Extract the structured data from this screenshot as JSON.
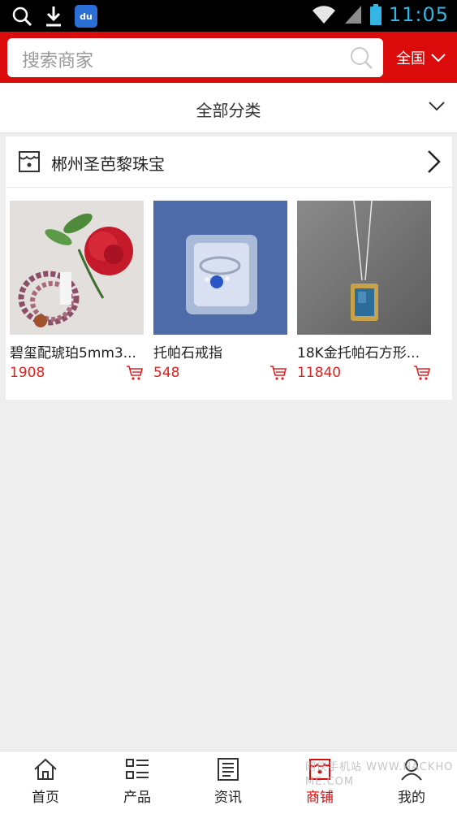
{
  "status_bar": {
    "time": "11:05",
    "icons": [
      "search-icon",
      "download-icon",
      "baidu-app-icon",
      "wifi-icon",
      "signal-icon",
      "battery-icon"
    ],
    "baidu_label": "du"
  },
  "search": {
    "placeholder": "搜索商家",
    "region_label": "全国"
  },
  "category_bar": {
    "label": "全部分类"
  },
  "shop": {
    "name": "郴州圣芭黎珠宝",
    "products": [
      {
        "name": "碧玺配琥珀5mm3...",
        "price": "1908"
      },
      {
        "name": "托帕石戒指",
        "price": "548"
      },
      {
        "name": "18K金托帕石方形...",
        "price": "11840"
      }
    ]
  },
  "bottom_nav": {
    "items": [
      {
        "label": "首页",
        "icon": "home-icon"
      },
      {
        "label": "产品",
        "icon": "list-icon"
      },
      {
        "label": "资讯",
        "icon": "news-icon"
      },
      {
        "label": "商铺",
        "icon": "shop-icon",
        "active": true
      },
      {
        "label": "我的",
        "icon": "user-icon"
      }
    ]
  },
  "watermark": "网侠手机站 WWW.HACKHOME.COM",
  "colors": {
    "brand_red": "#dc0b0b",
    "price_red": "#e02020",
    "time_blue": "#33b5e5"
  }
}
